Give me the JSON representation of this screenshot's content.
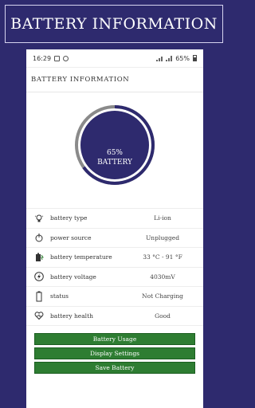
{
  "banner": {
    "title": "BATTERY INFORMATION"
  },
  "statusbar": {
    "time": "16:29",
    "battery_percent": "65%"
  },
  "appbar": {
    "title": "BATTERY INFORMATION"
  },
  "gauge": {
    "level_percent": 65,
    "percent_label": "65%",
    "caption": "BATTERY",
    "ring_color": "#2e2a6e",
    "track_color": "#8a8a8a"
  },
  "rows": [
    {
      "icon": "lightbulb-icon",
      "label": "battery type",
      "value": "Li-ion"
    },
    {
      "icon": "power-icon",
      "label": "power source",
      "value": "Unplugged"
    },
    {
      "icon": "thermometer-icon",
      "label": "battery temperature",
      "value": "33 °C - 91 °F"
    },
    {
      "icon": "lightning-icon",
      "label": "battery voltage",
      "value": "4030mV"
    },
    {
      "icon": "battery-icon",
      "label": "status",
      "value": "Not Charging"
    },
    {
      "icon": "heart-icon",
      "label": "battery health",
      "value": "Good"
    }
  ],
  "buttons": {
    "usage": "Battery Usage",
    "display": "Display Settings",
    "save": "Save Battery"
  },
  "colors": {
    "background": "#2e2a6e",
    "button": "#2e7d32"
  }
}
